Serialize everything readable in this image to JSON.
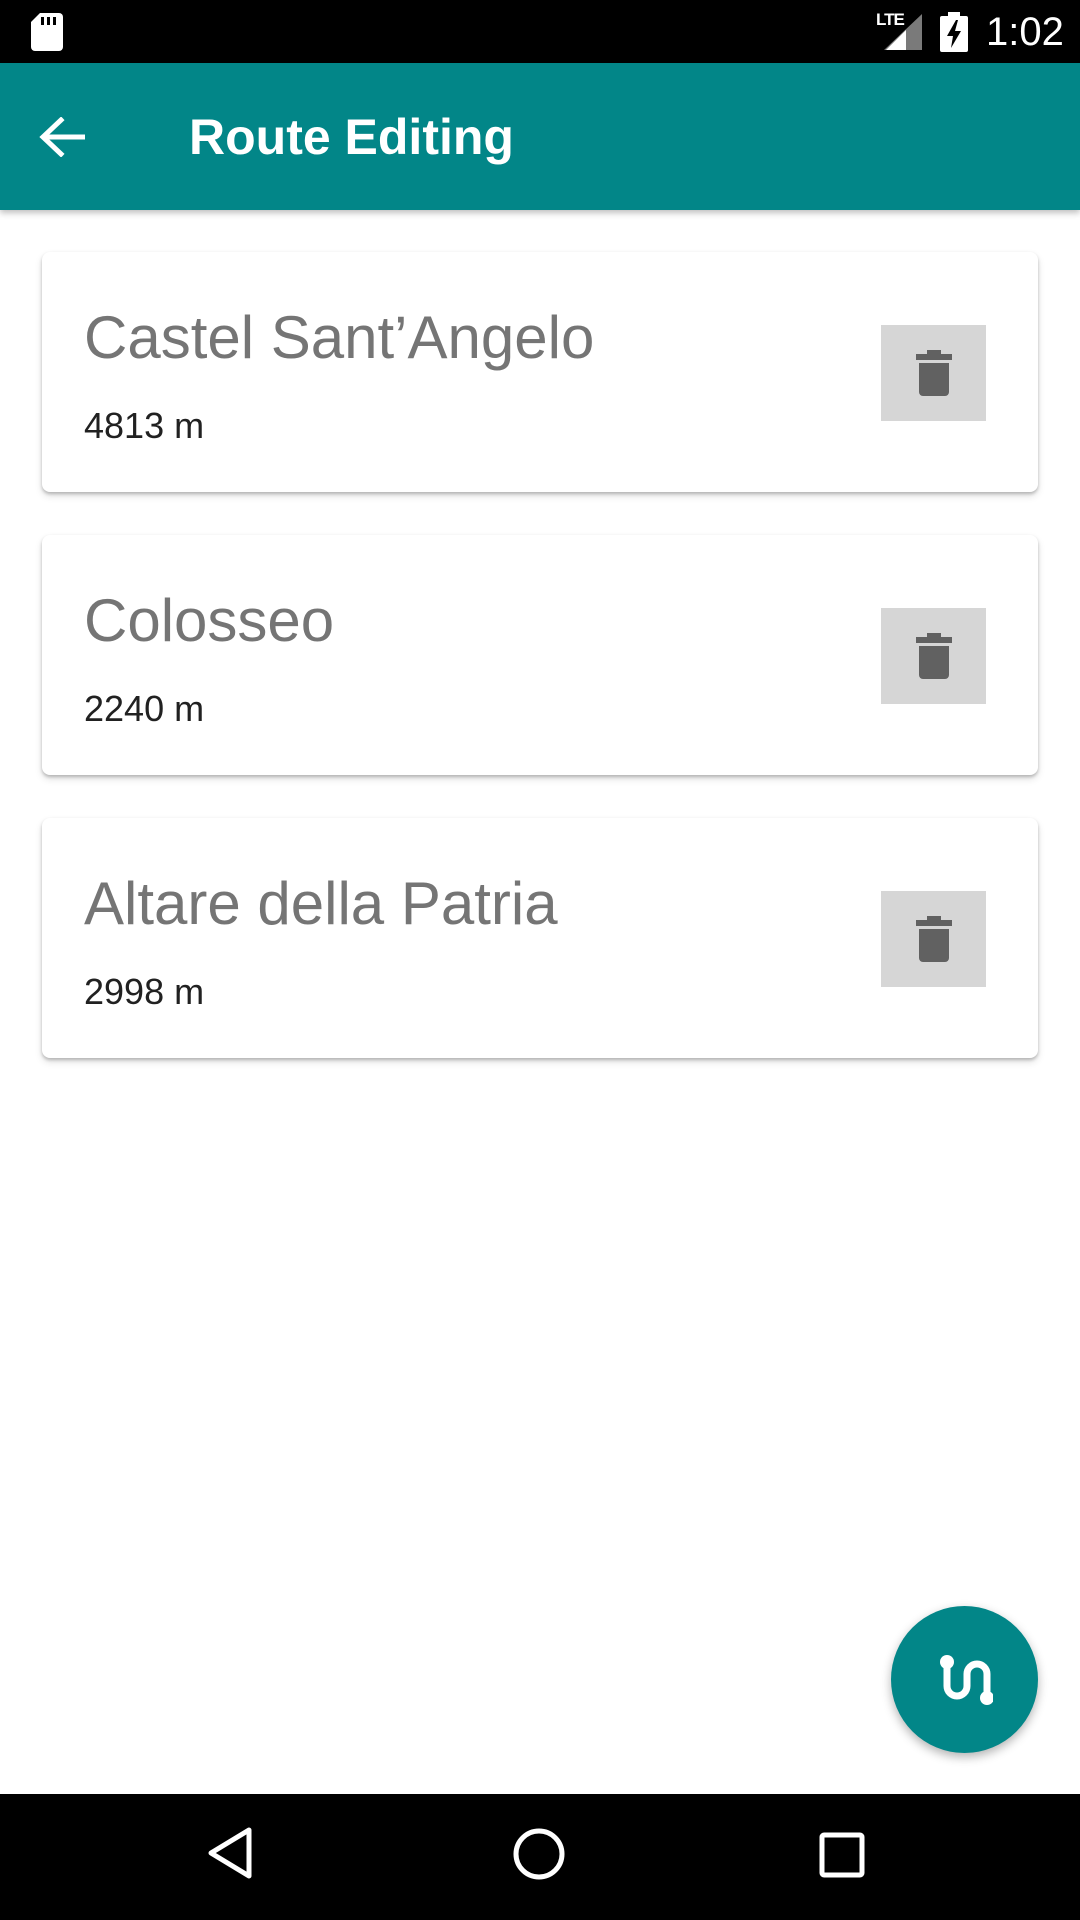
{
  "status_bar": {
    "network_label": "LTE",
    "time": "1:02",
    "icons": [
      "sd-card-icon",
      "signal-icon",
      "battery-charging-icon"
    ]
  },
  "app_bar": {
    "title": "Route Editing",
    "back_icon": "arrow-back-icon",
    "color": "#028688"
  },
  "route_stops": [
    {
      "name": "Castel Sant’Angelo",
      "distance": "4813 m",
      "action_icon": "trash-icon"
    },
    {
      "name": "Colosseo",
      "distance": "2240 m",
      "action_icon": "trash-icon"
    },
    {
      "name": "Altare della Patria",
      "distance": "2998 m",
      "action_icon": "trash-icon"
    }
  ],
  "fab": {
    "icon": "route-icon",
    "color": "#028688"
  },
  "nav_bar": {
    "icons": [
      "nav-back-icon",
      "nav-home-icon",
      "nav-recents-icon"
    ]
  }
}
